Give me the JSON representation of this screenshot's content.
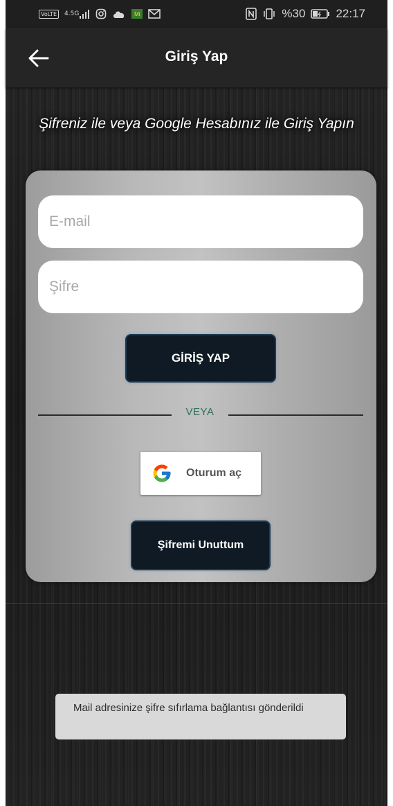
{
  "status_bar": {
    "volte": "VoLTE",
    "network": "4.5G",
    "app_badge": "Mi",
    "battery_percent": "%30",
    "clock": "22:17",
    "icons": [
      "volte-icon",
      "signal-icon",
      "instagram-icon",
      "cloud-icon",
      "app-badge-icon",
      "mail-icon",
      "nfc-icon",
      "vibrate-icon",
      "battery-icon"
    ]
  },
  "app_bar": {
    "title": "Giriş Yap",
    "back_icon": "arrow-left-icon"
  },
  "subtitle": "Şifreniz ile veya Google Hesabınız ile Giriş Yapın",
  "form": {
    "email_placeholder": "E-mail",
    "password_placeholder": "Şifre",
    "login_button": "GİRİŞ YAP",
    "divider_text": "VEYA",
    "google_button": "Oturum aç",
    "forgot_button": "Şifremi Unuttum"
  },
  "toast": {
    "message": "Mail adresinize şifre sıfırlama bağlantısı gönderildi"
  },
  "colors": {
    "button_dark": "#0f1a24",
    "divider_text": "#2f6f5c",
    "card_gray": "#b8b8b8",
    "app_bar": "#252525"
  }
}
